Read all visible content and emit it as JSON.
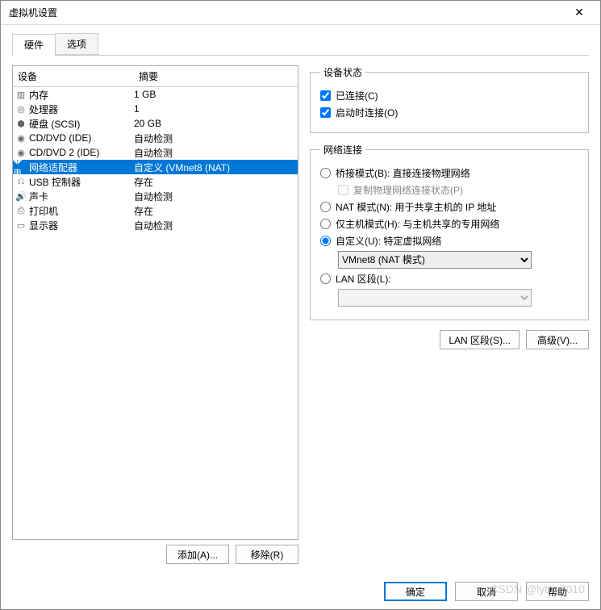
{
  "window": {
    "title": "虚拟机设置"
  },
  "tabs": {
    "hardware": "硬件",
    "options": "选项"
  },
  "table": {
    "col_device": "设备",
    "col_summary": "摘要",
    "rows": [
      {
        "icon": "memory-icon",
        "glyph": "▥",
        "device": "内存",
        "summary": "1 GB"
      },
      {
        "icon": "cpu-icon",
        "glyph": "◎",
        "device": "处理器",
        "summary": "1"
      },
      {
        "icon": "disk-icon",
        "glyph": "⬢",
        "device": "硬盘 (SCSI)",
        "summary": "20 GB"
      },
      {
        "icon": "cd-icon",
        "glyph": "◉",
        "device": "CD/DVD (IDE)",
        "summary": "自动检测"
      },
      {
        "icon": "cd-icon",
        "glyph": "◉",
        "device": "CD/DVD 2 (IDE)",
        "summary": "自动检测"
      },
      {
        "icon": "network-icon",
        "glyph": "�串",
        "device": "网络适配器",
        "summary": "自定义 (VMnet8 (NAT)",
        "selected": true
      },
      {
        "icon": "usb-icon",
        "glyph": "⎌",
        "device": "USB 控制器",
        "summary": "存在"
      },
      {
        "icon": "sound-icon",
        "glyph": "🔊",
        "device": "声卡",
        "summary": "自动检测"
      },
      {
        "icon": "printer-icon",
        "glyph": "⎙",
        "device": "打印机",
        "summary": "存在"
      },
      {
        "icon": "display-icon",
        "glyph": "▭",
        "device": "显示器",
        "summary": "自动检测"
      }
    ]
  },
  "left_buttons": {
    "add": "添加(A)...",
    "remove": "移除(R)"
  },
  "status_group": {
    "legend": "设备状态",
    "connected": "已连接(C)",
    "connect_on_power": "启动时连接(O)"
  },
  "net_group": {
    "legend": "网络连接",
    "bridged": "桥接模式(B): 直接连接物理网络",
    "replicate": "复制物理网络连接状态(P)",
    "nat": "NAT 模式(N): 用于共享主机的 IP 地址",
    "hostonly": "仅主机模式(H): 与主机共享的专用网络",
    "custom": "自定义(U): 特定虚拟网络",
    "custom_select": "VMnet8 (NAT 模式)",
    "lan": "LAN 区段(L):"
  },
  "right_buttons": {
    "lan_segments": "LAN 区段(S)...",
    "advanced": "高级(V)..."
  },
  "dialog_buttons": {
    "ok": "确定",
    "cancel": "取消",
    "help": "帮助"
  },
  "watermark": "CSDN @lythy2010"
}
